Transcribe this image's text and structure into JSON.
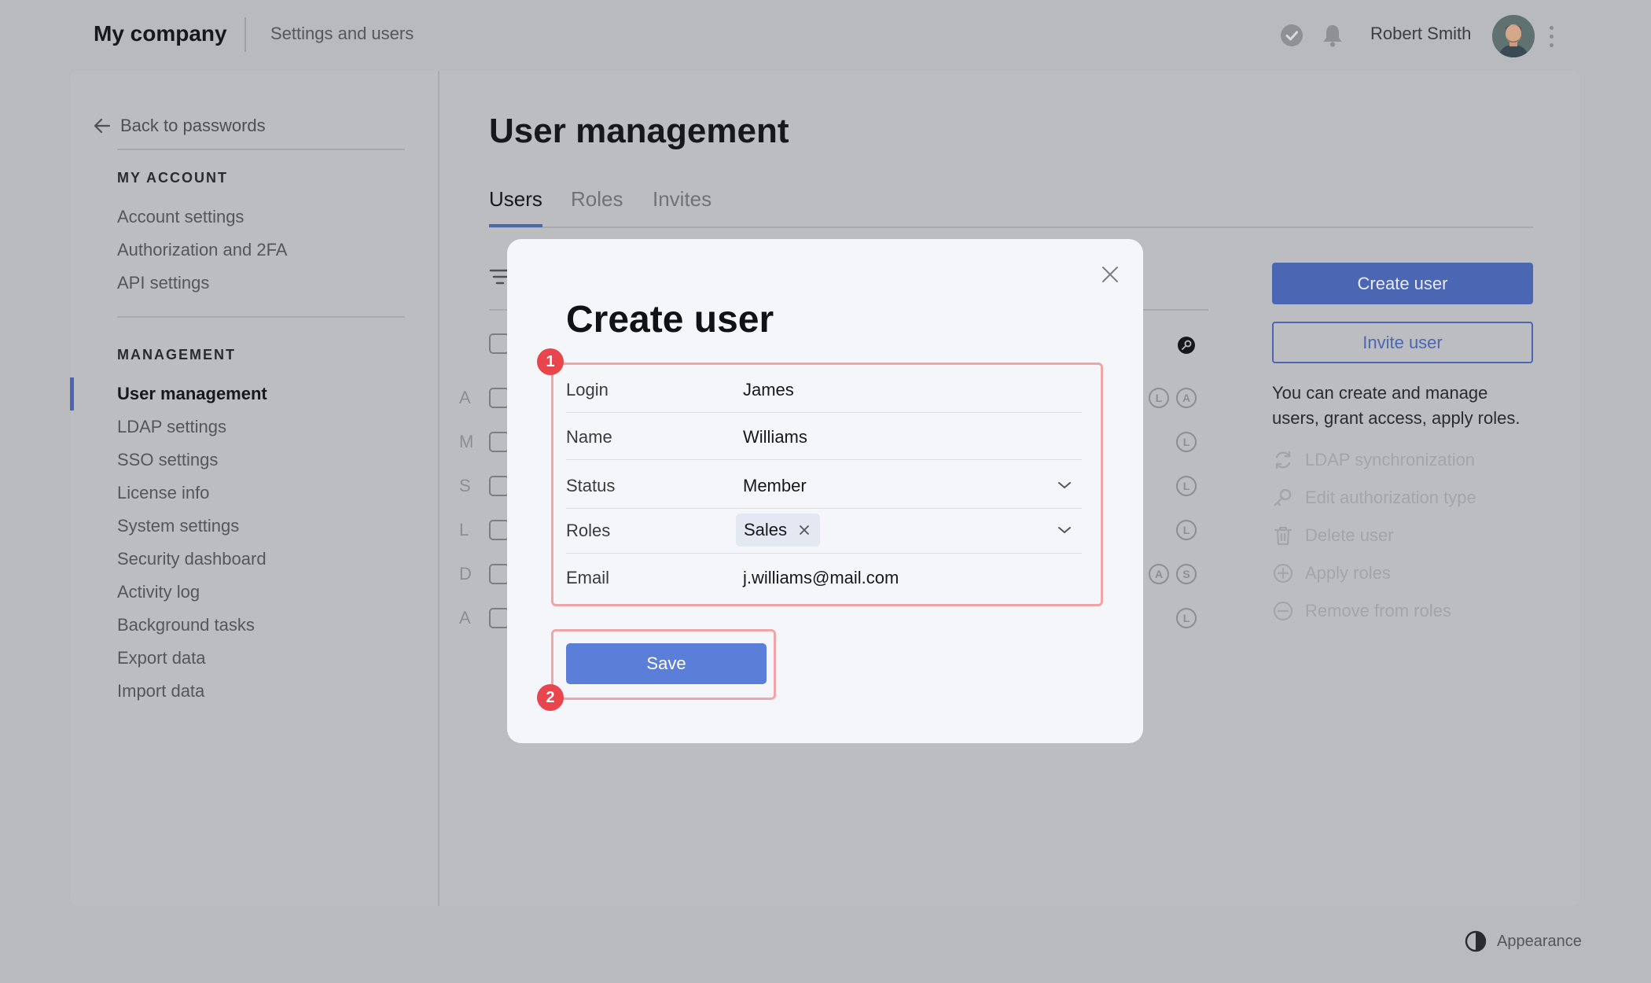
{
  "header": {
    "brand": "My company",
    "subtitle": "Settings and users",
    "user_name": "Robert Smith"
  },
  "sidebar": {
    "back_label": "Back to passwords",
    "sections": [
      {
        "title": "MY ACCOUNT",
        "items": [
          "Account settings",
          "Authorization and 2FA",
          "API settings"
        ]
      },
      {
        "title": "MANAGEMENT",
        "items": [
          "User management",
          "LDAP settings",
          "SSO settings",
          "License info",
          "System settings",
          "Security dashboard",
          "Activity log",
          "Background tasks",
          "Export data",
          "Import data"
        ]
      }
    ],
    "active_item": "User management"
  },
  "main": {
    "title": "User management",
    "tabs": [
      "Users",
      "Roles",
      "Invites"
    ],
    "active_tab": "Users",
    "rows": [
      {
        "letter": "A",
        "badges": [
          "L",
          "A"
        ]
      },
      {
        "letter": "M",
        "badges": [
          "L"
        ]
      },
      {
        "letter": "S",
        "badges": [
          "L"
        ]
      },
      {
        "letter": "L",
        "badges": [
          "L"
        ]
      },
      {
        "letter": "D",
        "badges": [
          "A",
          "S"
        ]
      },
      {
        "letter": "A",
        "badges": [
          "L"
        ]
      }
    ]
  },
  "right_panel": {
    "create_label": "Create user",
    "invite_label": "Invite user",
    "help_text": "You can create and manage users, grant access, apply roles.",
    "actions": [
      "LDAP synchronization",
      "Edit authorization type",
      "Delete user",
      "Apply roles",
      "Remove from roles"
    ]
  },
  "modal": {
    "title": "Create user",
    "fields": [
      {
        "label": "Login",
        "value": "James"
      },
      {
        "label": "Name",
        "value": "Williams"
      },
      {
        "label": "Status",
        "value": "Member"
      },
      {
        "label": "Roles",
        "value": "Sales"
      },
      {
        "label": "Email",
        "value": "j.williams@mail.com"
      }
    ],
    "save_label": "Save",
    "markers": [
      "1",
      "2"
    ]
  },
  "footer": {
    "appearance_label": "Appearance"
  },
  "colors": {
    "accent": "#4b66b3",
    "save_button": "#5b7fd9",
    "marker": "#e8454c",
    "highlight_border": "#f0a5a9"
  },
  "icons": [
    "arrow-left-icon",
    "check-circle-icon",
    "bell-icon",
    "kebab-icon",
    "filter-icon",
    "key-icon",
    "sync-icon",
    "close-icon",
    "chevron-down-icon",
    "trash-icon",
    "plus-circle-icon",
    "minus-circle-icon",
    "half-circle-icon"
  ]
}
